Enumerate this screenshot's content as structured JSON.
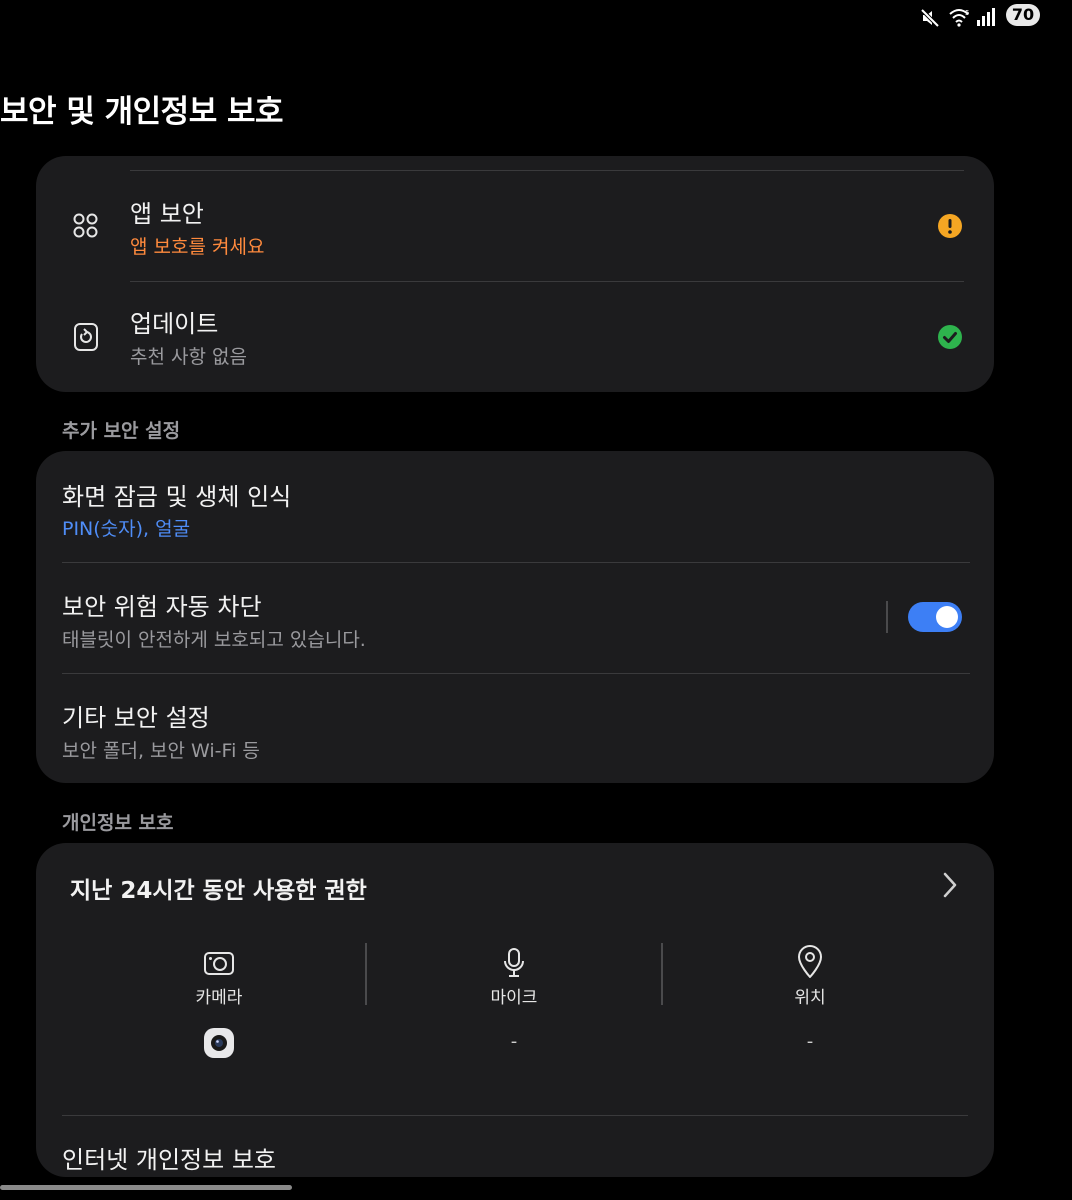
{
  "status_bar": {
    "mute_icon": "mute-icon",
    "wifi_icon": "wifi-icon",
    "signal_icon": "signal-icon",
    "battery": "70"
  },
  "page_title": "보안 및 개인정보 보호",
  "security_card": {
    "items": [
      {
        "icon": "app-security-icon",
        "title": "앱 보안",
        "subtitle": "앱 보호를 켜세요",
        "status_icon": "warning-icon",
        "status_color": "#f5a623"
      },
      {
        "icon": "update-icon",
        "title": "업데이트",
        "subtitle": "추천 사항 없음",
        "status_icon": "check-icon",
        "status_color": "#2eb34d"
      }
    ]
  },
  "additional_security": {
    "header": "추가 보안 설정",
    "items": [
      {
        "title": "화면 잠금 및 생체 인식",
        "subtitle": "PIN(숫자), 얼굴"
      },
      {
        "title": "보안 위험 자동 차단",
        "subtitle": "태블릿이 안전하게 보호되고 있습니다.",
        "toggle_on": true
      },
      {
        "title": "기타 보안 설정",
        "subtitle": "보안 폴더, 보안 Wi-Fi 등"
      }
    ]
  },
  "privacy": {
    "header": "개인정보 보호",
    "permissions_title": "지난 24시간 동안 사용한 권한",
    "permissions": [
      {
        "icon": "camera-icon",
        "label": "카메라",
        "usage": "camera-app-icon"
      },
      {
        "icon": "microphone-icon",
        "label": "마이크",
        "usage": "-"
      },
      {
        "icon": "location-icon",
        "label": "위치",
        "usage": "-"
      }
    ],
    "internet_privacy": "인터넷 개인정보 보호"
  },
  "colors": {
    "background": "#000000",
    "card": "#1c1c1e",
    "accent_blue": "#3d7ff5",
    "warning_orange": "#ff8a3d"
  }
}
